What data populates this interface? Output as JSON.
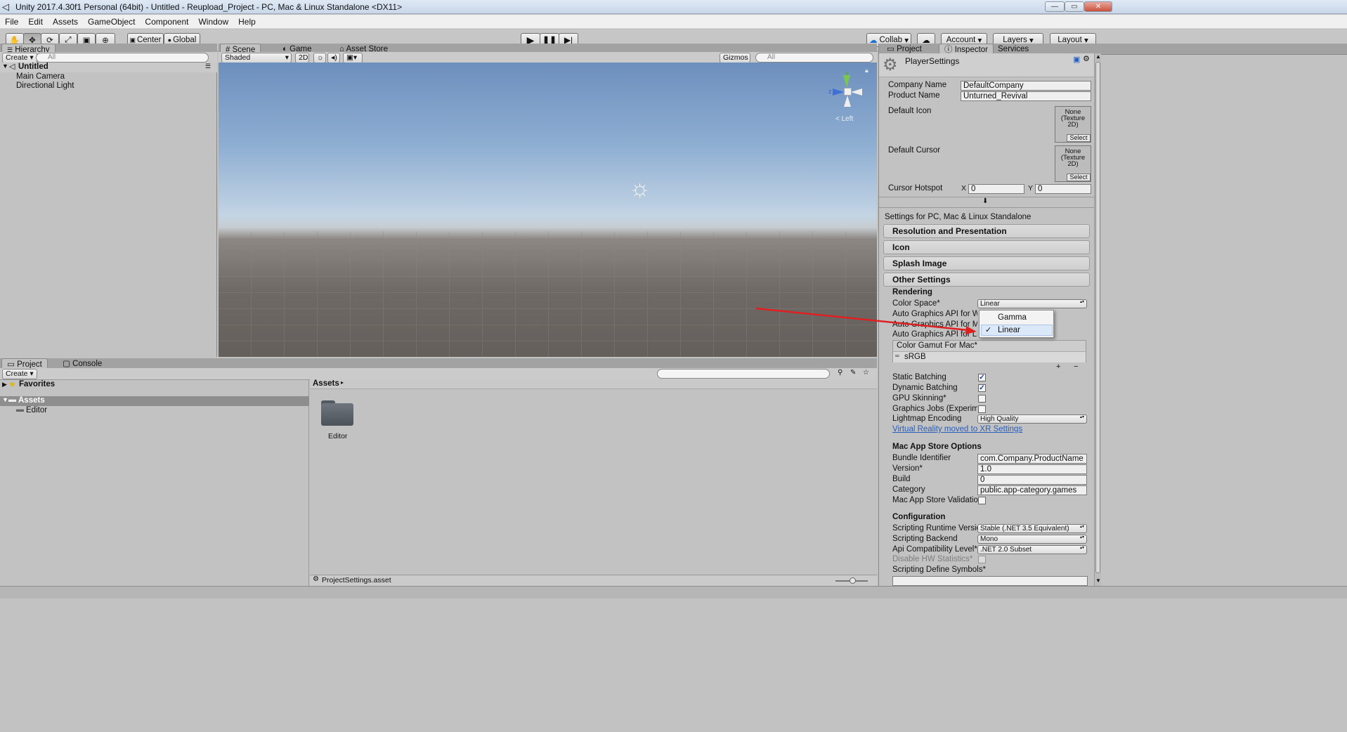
{
  "window": {
    "title": "Unity 2017.4.30f1 Personal (64bit) - Untitled - Reupload_Project - PC, Mac & Linux Standalone <DX11>",
    "minimize": "—",
    "maximize": "▭",
    "close": "✕"
  },
  "menu": [
    "File",
    "Edit",
    "Assets",
    "GameObject",
    "Component",
    "Window",
    "Help"
  ],
  "toolbar": {
    "center": "Center",
    "global": "Global",
    "collab": "Collab",
    "account": "Account",
    "layers": "Layers",
    "layout": "Layout"
  },
  "hierarchy": {
    "tab": "Hierarchy",
    "create": "Create",
    "search_placeholder": "All",
    "scene": "Untitled",
    "items": [
      "Main Camera",
      "Directional Light"
    ]
  },
  "scene_view": {
    "tabs": [
      "Scene",
      "Game",
      "Asset Store"
    ],
    "shading": "Shaded",
    "mode_2d": "2D",
    "gizmos": "Gizmos",
    "search_placeholder": "All",
    "gizmo_label": "Left",
    "axis_y": "y",
    "axis_z": "z"
  },
  "project": {
    "tabs": [
      "Project",
      "Console"
    ],
    "create": "Create",
    "favorites": "Favorites",
    "assets": "Assets",
    "editor": "Editor",
    "breadcrumb": "Assets",
    "folder_label": "Editor",
    "status_file": "ProjectSettings.asset"
  },
  "inspector": {
    "tabs": [
      "Project",
      "Inspector",
      "Services"
    ],
    "title": "PlayerSettings",
    "company_label": "Company Name",
    "company_value": "DefaultCompany",
    "product_label": "Product Name",
    "product_value": "Unturned_Revival",
    "default_icon": "Default Icon",
    "default_cursor": "Default Cursor",
    "texture_none": "None (Texture 2D)",
    "select": "Select",
    "hotspot_label": "Cursor Hotspot",
    "hotspot_x_label": "X",
    "hotspot_x": "0",
    "hotspot_y_label": "Y",
    "hotspot_y": "0",
    "platform_settings": "Settings for PC, Mac & Linux Standalone",
    "sections": [
      "Resolution and Presentation",
      "Icon",
      "Splash Image"
    ],
    "other_settings": "Other Settings",
    "rendering": "Rendering",
    "color_space_label": "Color Space*",
    "color_space_value": "Linear",
    "auto_api_win": "Auto Graphics API for Windows",
    "auto_api_mac": "Auto Graphics API for Mac",
    "auto_api_linux": "Auto Graphics API for Linux",
    "color_gamut": "Color Gamut For Mac*",
    "srgb": "sRGB",
    "static_batching": "Static Batching",
    "static_batching_checked": true,
    "dynamic_batching": "Dynamic Batching",
    "dynamic_batching_checked": true,
    "gpu_skinning": "GPU Skinning*",
    "gpu_skinning_checked": false,
    "graphics_jobs": "Graphics Jobs (Experimental)",
    "graphics_jobs_checked": false,
    "lightmap_encoding_label": "Lightmap Encoding",
    "lightmap_encoding_value": "High Quality",
    "vr_link": "Virtual Reality moved to XR Settings",
    "mac_store": "Mac App Store Options",
    "bundle_label": "Bundle Identifier",
    "bundle_value": "com.Company.ProductName",
    "version_label": "Version*",
    "version_value": "1.0",
    "build_label": "Build",
    "build_value": "0",
    "category_label": "Category",
    "category_value": "public.app-category.games",
    "validation_label": "Mac App Store Validation",
    "validation_checked": false,
    "configuration": "Configuration",
    "runtime_label": "Scripting Runtime Version",
    "runtime_value": "Stable (.NET 3.5 Equivalent)",
    "backend_label": "Scripting Backend",
    "backend_value": "Mono",
    "api_label": "Api Compatibility Level*",
    "api_value": ".NET 2.0 Subset",
    "hw_stats": "Disable HW Statistics*",
    "hw_stats_checked": false,
    "define_symbols": "Scripting Define Symbols*"
  },
  "dropdown": {
    "options": [
      "Gamma",
      "Linear"
    ],
    "selected": "Linear",
    "check": "✓"
  },
  "colors": {
    "annotation_arrow": "#e02020",
    "link": "#2a5db8"
  }
}
